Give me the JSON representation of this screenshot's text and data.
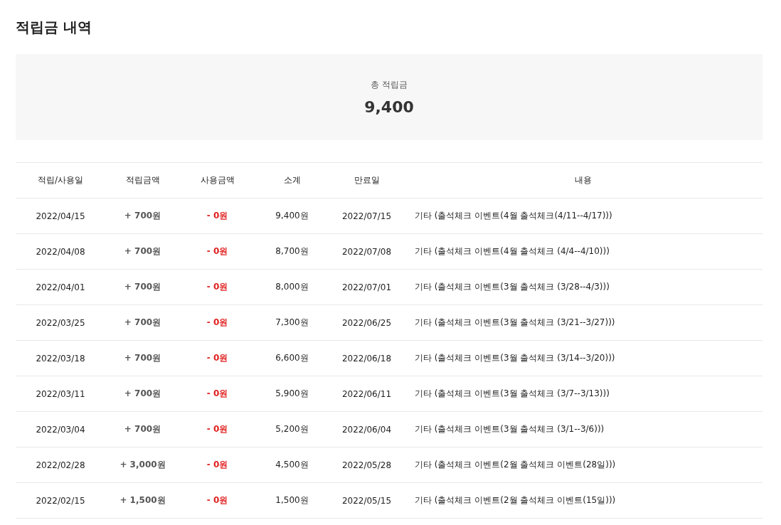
{
  "title": "적립금 내역",
  "summary": {
    "label": "총 적립금",
    "value": "9,400"
  },
  "table": {
    "columns": [
      "적립/사용일",
      "적립금액",
      "사용금액",
      "소계",
      "만료일",
      "내용"
    ],
    "rows": [
      {
        "date": "2022/04/15",
        "earned": "+ 700원",
        "used": "- 0원",
        "subtotal": "9,400원",
        "expires": "2022/07/15",
        "detail": "기타 (출석체크 이벤트(4월 출석체크(4/11--4/17)))"
      },
      {
        "date": "2022/04/08",
        "earned": "+ 700원",
        "used": "- 0원",
        "subtotal": "8,700원",
        "expires": "2022/07/08",
        "detail": "기타 (출석체크 이벤트(4월 출석체크 (4/4--4/10)))"
      },
      {
        "date": "2022/04/01",
        "earned": "+ 700원",
        "used": "- 0원",
        "subtotal": "8,000원",
        "expires": "2022/07/01",
        "detail": "기타 (출석체크 이벤트(3월 출석체크 (3/28--4/3)))"
      },
      {
        "date": "2022/03/25",
        "earned": "+ 700원",
        "used": "- 0원",
        "subtotal": "7,300원",
        "expires": "2022/06/25",
        "detail": "기타 (출석체크 이벤트(3월 출석체크 (3/21--3/27)))"
      },
      {
        "date": "2022/03/18",
        "earned": "+ 700원",
        "used": "- 0원",
        "subtotal": "6,600원",
        "expires": "2022/06/18",
        "detail": "기타 (출석체크 이벤트(3월 출석체크 (3/14--3/20)))"
      },
      {
        "date": "2022/03/11",
        "earned": "+ 700원",
        "used": "- 0원",
        "subtotal": "5,900원",
        "expires": "2022/06/11",
        "detail": "기타 (출석체크 이벤트(3월 출석체크 (3/7--3/13)))"
      },
      {
        "date": "2022/03/04",
        "earned": "+ 700원",
        "used": "- 0원",
        "subtotal": "5,200원",
        "expires": "2022/06/04",
        "detail": "기타 (출석체크 이벤트(3월 출석체크 (3/1--3/6)))"
      },
      {
        "date": "2022/02/28",
        "earned": "+ 3,000원",
        "used": "- 0원",
        "subtotal": "4,500원",
        "expires": "2022/05/28",
        "detail": "기타 (출석체크 이벤트(2월 출석체크 이벤트(28일)))"
      },
      {
        "date": "2022/02/15",
        "earned": "+ 1,500원",
        "used": "- 0원",
        "subtotal": "1,500원",
        "expires": "2022/05/15",
        "detail": "기타 (출석체크 이벤트(2월 출석체크 이벤트(15일)))"
      }
    ]
  }
}
